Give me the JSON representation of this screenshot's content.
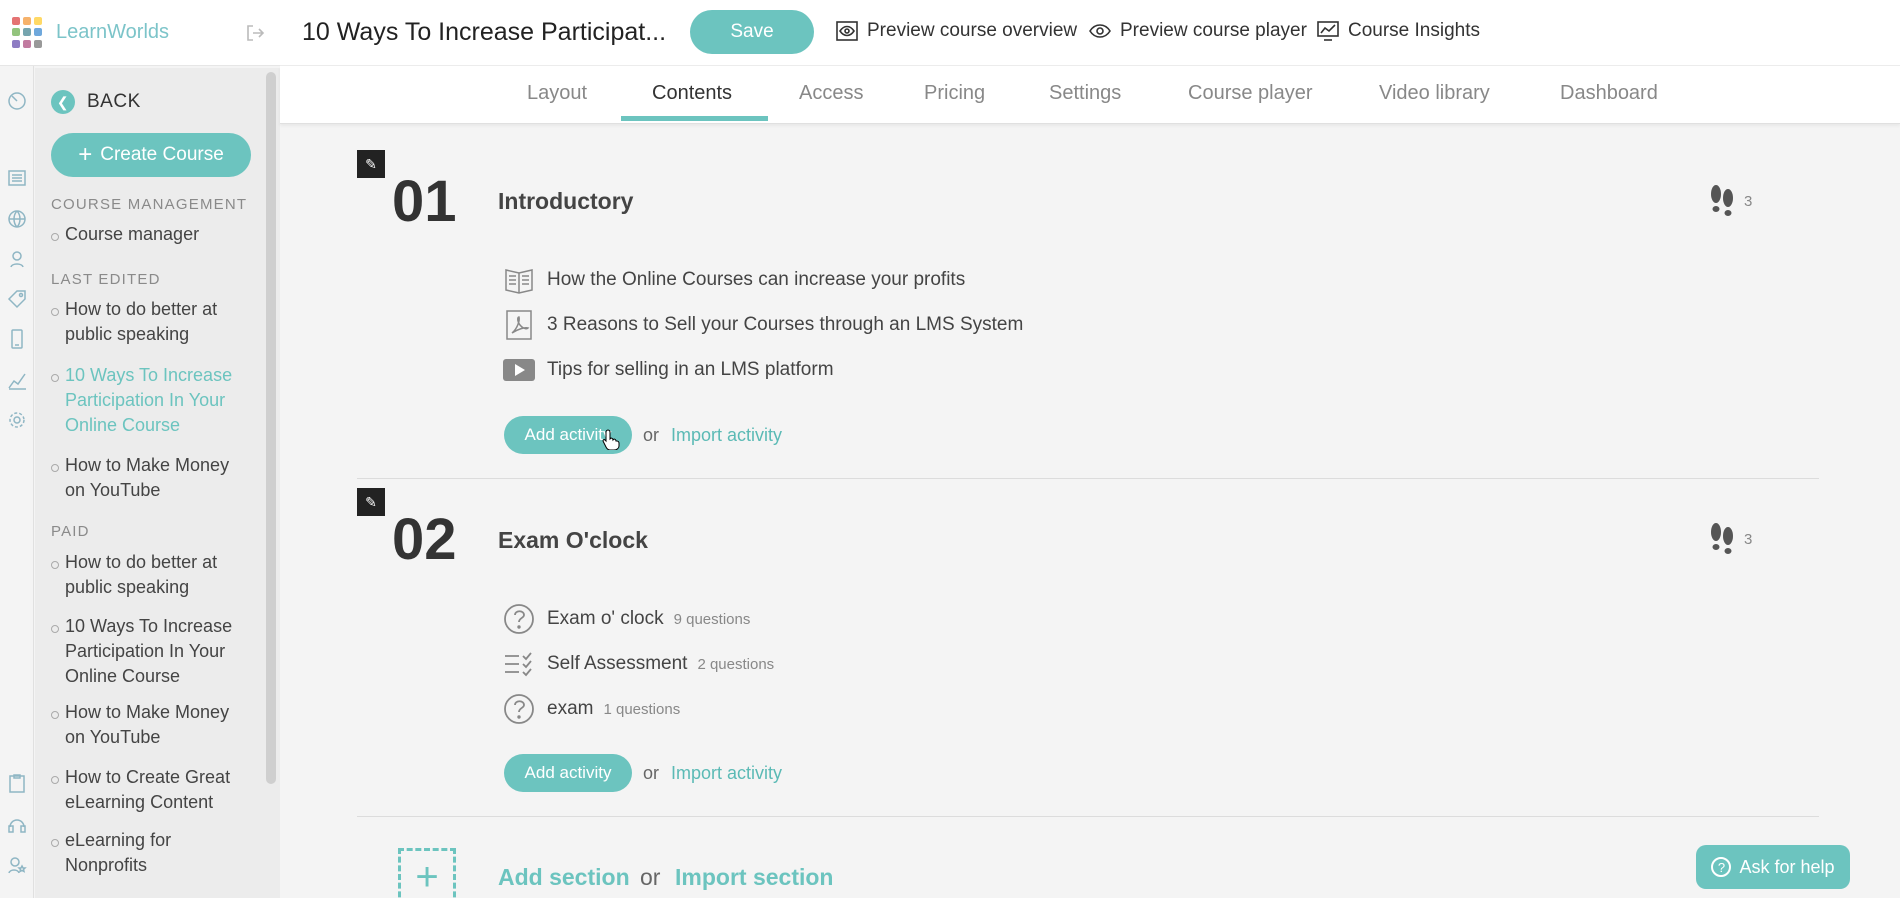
{
  "brand": {
    "name": "LearnWorlds",
    "logo_colors": [
      "#e57373",
      "#f6b26b",
      "#ffd966",
      "#93c47d",
      "#76a5af",
      "#6fa8dc",
      "#8e7cc3",
      "#c27ba0",
      "#999999"
    ]
  },
  "header": {
    "course_title": "10 Ways To Increase Participat...",
    "save_label": "Save",
    "links": [
      "Preview course overview",
      "Preview course player",
      "Course Insights"
    ]
  },
  "tabs": [
    "Layout",
    "Contents",
    "Access",
    "Pricing",
    "Settings",
    "Course player",
    "Video library",
    "Dashboard"
  ],
  "active_tab": "Contents",
  "sidebar": {
    "back_label": "BACK",
    "create_label": "Create Course",
    "sections": [
      {
        "title": "COURSE MANAGEMENT",
        "items": [
          "Course manager"
        ]
      },
      {
        "title": "LAST EDITED",
        "items": [
          "How to do better at public speaking",
          "10 Ways To Increase Participation In Your Online Course",
          "How to Make Money on YouTube"
        ]
      },
      {
        "title": "PAID",
        "items": [
          "How to do better at public speaking",
          "10 Ways To Increase Participation In Your Online Course",
          "How to Make Money on YouTube",
          "How to Create Great eLearning Content",
          "eLearning for Nonprofits"
        ]
      }
    ]
  },
  "course_sections": [
    {
      "number": "01",
      "title": "Introductory",
      "steps": "3",
      "activities": [
        {
          "icon": "ebook-icon",
          "title": "How the Online Courses can increase your profits",
          "meta": ""
        },
        {
          "icon": "pdf-icon",
          "title": "3 Reasons to Sell your Courses through an LMS System",
          "meta": ""
        },
        {
          "icon": "video-icon",
          "title": "Tips for selling in an LMS platform",
          "meta": ""
        }
      ]
    },
    {
      "number": "02",
      "title": "Exam O'clock",
      "steps": "3",
      "activities": [
        {
          "icon": "question-icon",
          "title": "Exam o' clock",
          "meta": "9 questions"
        },
        {
          "icon": "checklist-icon",
          "title": "Self Assessment",
          "meta": "2 questions"
        },
        {
          "icon": "question-icon",
          "title": "exam",
          "meta": "1 questions"
        }
      ]
    }
  ],
  "labels": {
    "add_activity": "Add activity",
    "or": "or",
    "import_activity": "Import activity",
    "add_section": "Add section",
    "import_section": "Import section",
    "ask_help": "Ask for help"
  },
  "colors": {
    "accent": "#6cc4bf",
    "background": "#f4f4f4"
  }
}
